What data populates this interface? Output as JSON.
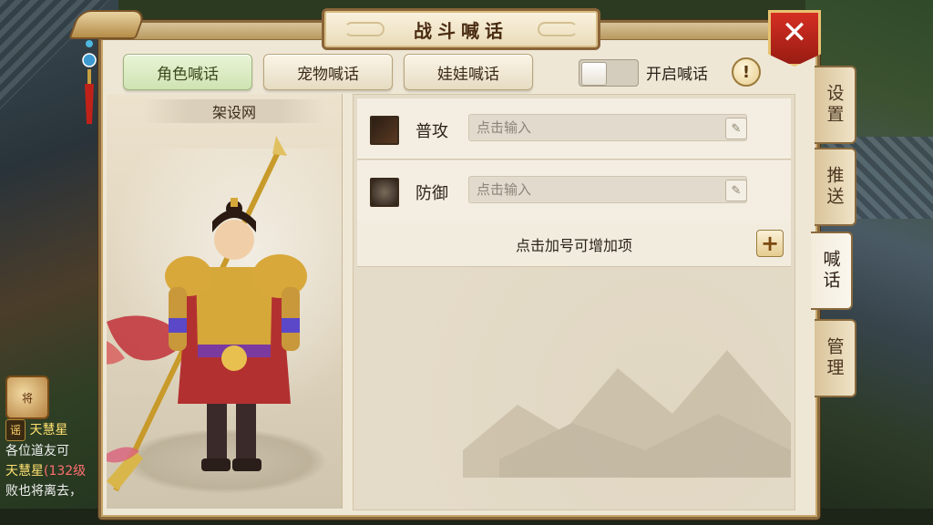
{
  "modal": {
    "title": "战斗喊话",
    "close_label": "✕"
  },
  "top_tabs": [
    {
      "label": "角色喊话",
      "active": true
    },
    {
      "label": "宠物喊话",
      "active": false
    },
    {
      "label": "娃娃喊话",
      "active": false
    }
  ],
  "shout_toggle": {
    "label": "开启喊话",
    "on": false
  },
  "info_icon": "!",
  "character": {
    "name": "架设网"
  },
  "shouts": [
    {
      "skill": "普攻",
      "icon": "sword-icon",
      "value": "",
      "placeholder": "点击输入"
    },
    {
      "skill": "防御",
      "icon": "shield-icon",
      "value": "",
      "placeholder": "点击输入"
    }
  ],
  "add_hint": "点击加号可增加项",
  "add_symbol": "+",
  "side_tabs": [
    {
      "label": "设置",
      "active": false
    },
    {
      "label": "推送",
      "active": false
    },
    {
      "label": "喊话",
      "active": true
    },
    {
      "label": "管理",
      "active": false
    }
  ],
  "background_chat": {
    "badge": "将",
    "lines": [
      {
        "tag": "谣",
        "name": "天慧星",
        "text": ""
      },
      {
        "tag": "",
        "name": "",
        "text": "各位道友可"
      },
      {
        "tag": "",
        "name": "天慧星",
        "text": "(132级"
      },
      {
        "tag": "",
        "name": "",
        "text": "败也将离去，"
      }
    ]
  },
  "colors": {
    "title_text": "#4a2c12",
    "close_red": "#c6281d",
    "active_tab": "#d8eac0",
    "panel_bg": "#efe7d6"
  }
}
